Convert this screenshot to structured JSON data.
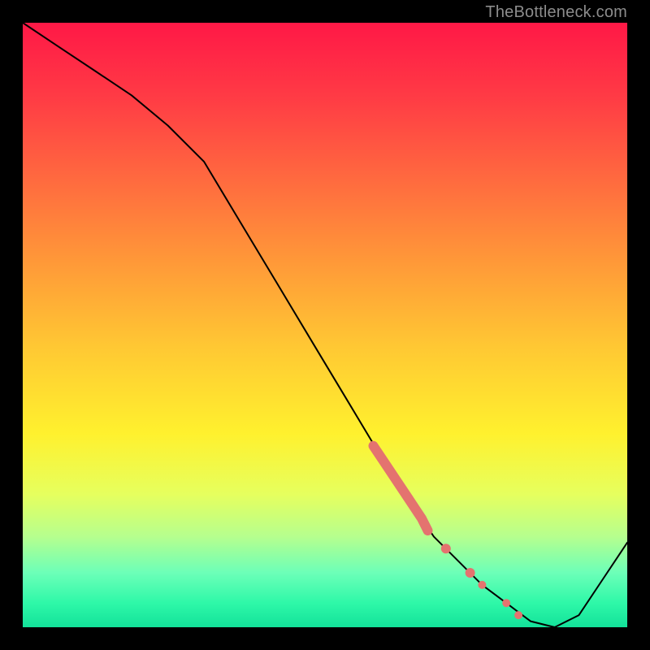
{
  "watermark": "TheBottleneck.com",
  "colors": {
    "curve": "#000000",
    "highlight": "#e4736f",
    "gradient_top": "#ff1846",
    "gradient_bottom": "#13e29a"
  },
  "chart_data": {
    "type": "line",
    "title": "",
    "xlabel": "",
    "ylabel": "",
    "xlim": [
      0,
      100
    ],
    "ylim": [
      0,
      100
    ],
    "grid": false,
    "legend": false,
    "series": [
      {
        "name": "curve",
        "x": [
          0,
          6,
          12,
          18,
          24,
          30,
          36,
          42,
          48,
          54,
          60,
          64,
          68,
          72,
          76,
          80,
          84,
          88,
          92,
          96,
          100
        ],
        "values": [
          100,
          96,
          92,
          88,
          83,
          77,
          67,
          57,
          47,
          37,
          27,
          21,
          15,
          11,
          7,
          4,
          1,
          0,
          2,
          8,
          14
        ]
      }
    ],
    "highlight_segment": {
      "x": [
        58,
        60,
        62,
        64,
        66,
        67
      ],
      "values": [
        30,
        27,
        24,
        21,
        18,
        16
      ]
    },
    "highlight_points": [
      {
        "x": 70,
        "y": 13
      },
      {
        "x": 74,
        "y": 9
      },
      {
        "x": 76,
        "y": 7
      },
      {
        "x": 80,
        "y": 4
      },
      {
        "x": 82,
        "y": 2
      }
    ]
  }
}
